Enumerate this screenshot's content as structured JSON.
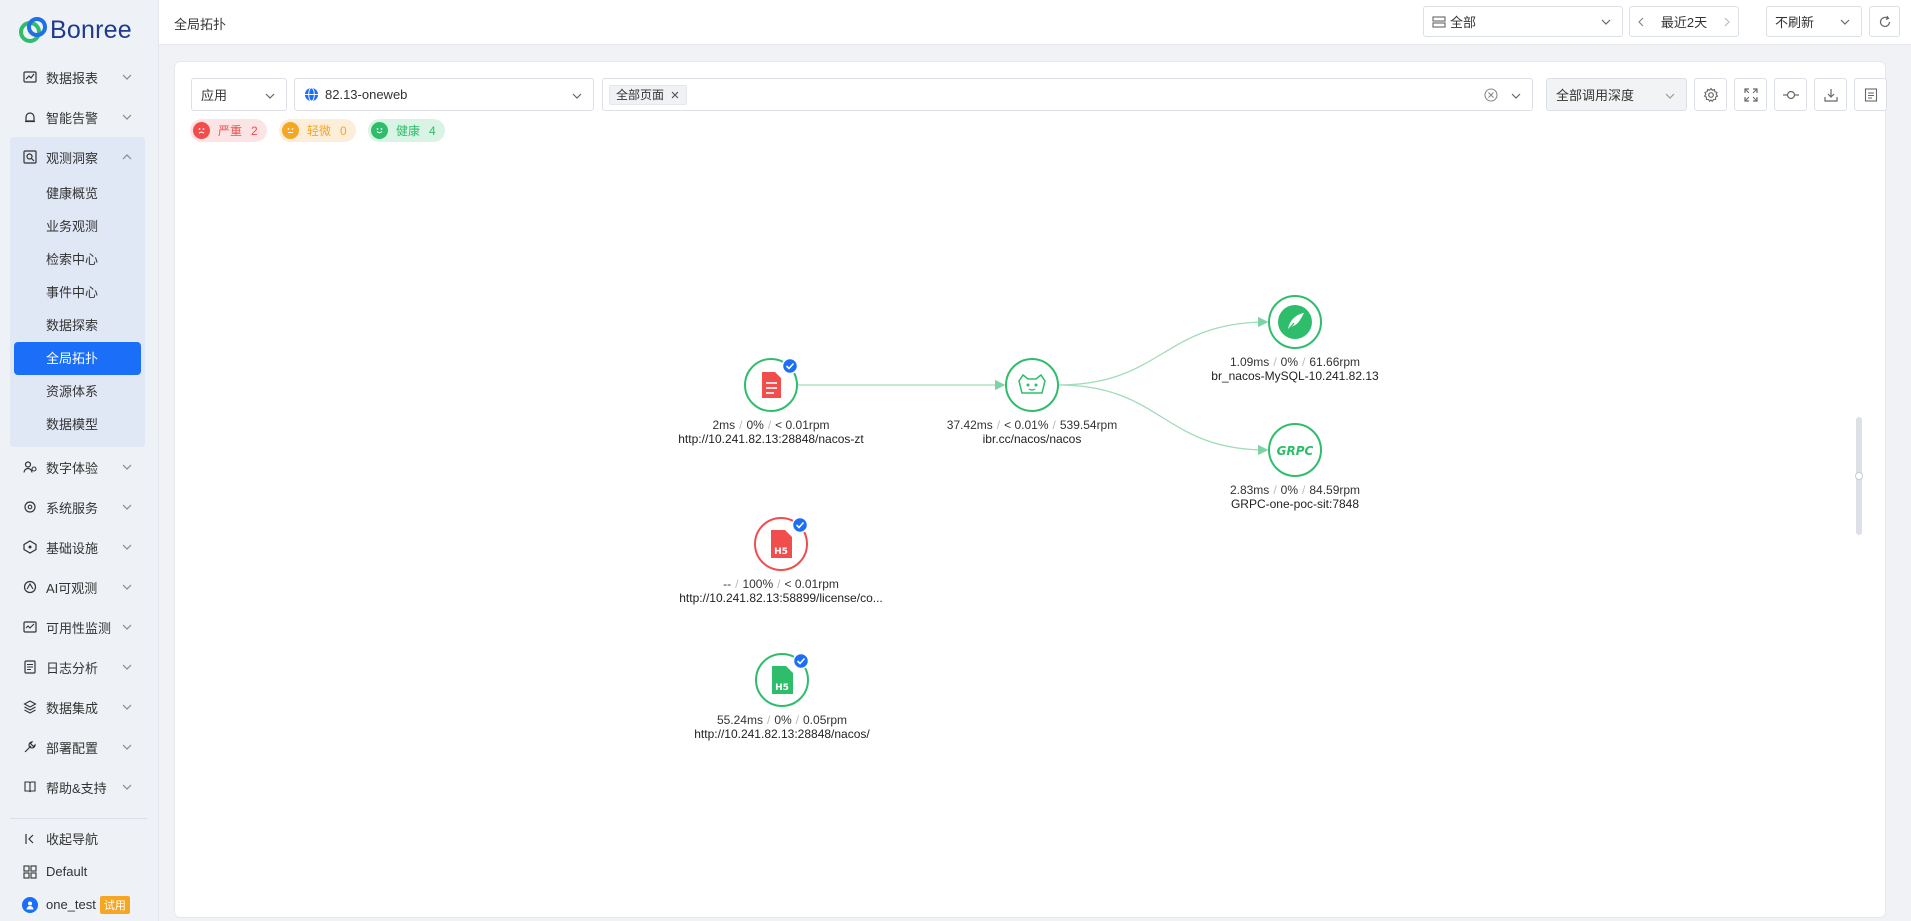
{
  "app": {
    "brand": "Bonree"
  },
  "sidebar": {
    "menu_top": [
      {
        "label": "数据报表",
        "icon": "report-icon"
      },
      {
        "label": "智能告警",
        "icon": "alarm-icon"
      }
    ],
    "open_group": {
      "label": "观测洞察",
      "icon": "observe-icon",
      "items": [
        "健康概览",
        "业务观测",
        "检索中心",
        "事件中心",
        "数据探索",
        "全局拓扑",
        "资源体系",
        "数据模型"
      ],
      "active": "全局拓扑"
    },
    "menu_bottom": [
      {
        "label": "数字体验",
        "icon": "user-experience-icon"
      },
      {
        "label": "系统服务",
        "icon": "system-service-icon"
      },
      {
        "label": "基础设施",
        "icon": "infrastructure-icon"
      },
      {
        "label": "AI可观测",
        "icon": "ai-observe-icon"
      },
      {
        "label": "可用性监测",
        "icon": "availability-icon"
      },
      {
        "label": "日志分析",
        "icon": "log-icon"
      },
      {
        "label": "数据集成",
        "icon": "data-integration-icon"
      },
      {
        "label": "部署配置",
        "icon": "deploy-config-icon"
      },
      {
        "label": "帮助&支持",
        "icon": "help-icon"
      }
    ],
    "footer": {
      "collapse": "收起导航",
      "workspace": "Default",
      "user": "one_test",
      "trial": "试用"
    }
  },
  "topbar": {
    "page_title": "全局拓扑",
    "scope_select": "全部",
    "time_range": "最近2天",
    "refresh_select": "不刷新"
  },
  "filters": {
    "type_select": "应用",
    "app_select": "82.13-oneweb",
    "page_tag": "全部页面",
    "depth_select": "全部调用深度"
  },
  "status": {
    "severe": {
      "label": "严重",
      "count": "2",
      "color": "#f04d4d"
    },
    "minor": {
      "label": "轻微",
      "count": "0",
      "color": "#f5a623"
    },
    "healthy": {
      "label": "健康",
      "count": "4",
      "color": "#2ebd6b"
    }
  },
  "topology": {
    "nodes": [
      {
        "id": "n1",
        "icon": "document-icon",
        "status": "healthy",
        "metrics": [
          "2ms",
          "0%",
          "< 0.01rpm"
        ],
        "name": "http://10.241.82.13:28848/nacos-zt",
        "checked": true
      },
      {
        "id": "n2",
        "icon": "tomcat-icon",
        "status": "healthy",
        "metrics": [
          "37.42ms",
          "< 0.01%",
          "539.54rpm"
        ],
        "name": "ibr.cc/nacos/nacos",
        "checked": false
      },
      {
        "id": "n3",
        "icon": "mysql-icon",
        "status": "healthy",
        "metrics": [
          "1.09ms",
          "0%",
          "61.66rpm"
        ],
        "name": "br_nacos-MySQL-10.241.82.13",
        "checked": false
      },
      {
        "id": "n4",
        "icon": "grpc-icon",
        "status": "healthy",
        "metrics": [
          "2.83ms",
          "0%",
          "84.59rpm"
        ],
        "name": "GRPC-one-poc-sit:7848",
        "checked": false
      },
      {
        "id": "n5",
        "icon": "h5-icon",
        "status": "severe",
        "metrics": [
          "--",
          "100%",
          "< 0.01rpm"
        ],
        "name": "http://10.241.82.13:58899/license/co...",
        "checked": true
      },
      {
        "id": "n6",
        "icon": "h5-icon",
        "status": "healthy",
        "metrics": [
          "55.24ms",
          "0%",
          "0.05rpm"
        ],
        "name": "http://10.241.82.13:28848/nacos/",
        "checked": true
      }
    ],
    "edges": [
      [
        "n1",
        "n2"
      ],
      [
        "n2",
        "n3"
      ],
      [
        "n2",
        "n4"
      ]
    ],
    "grpc_text": "GRPC",
    "h5_text": "H5"
  }
}
